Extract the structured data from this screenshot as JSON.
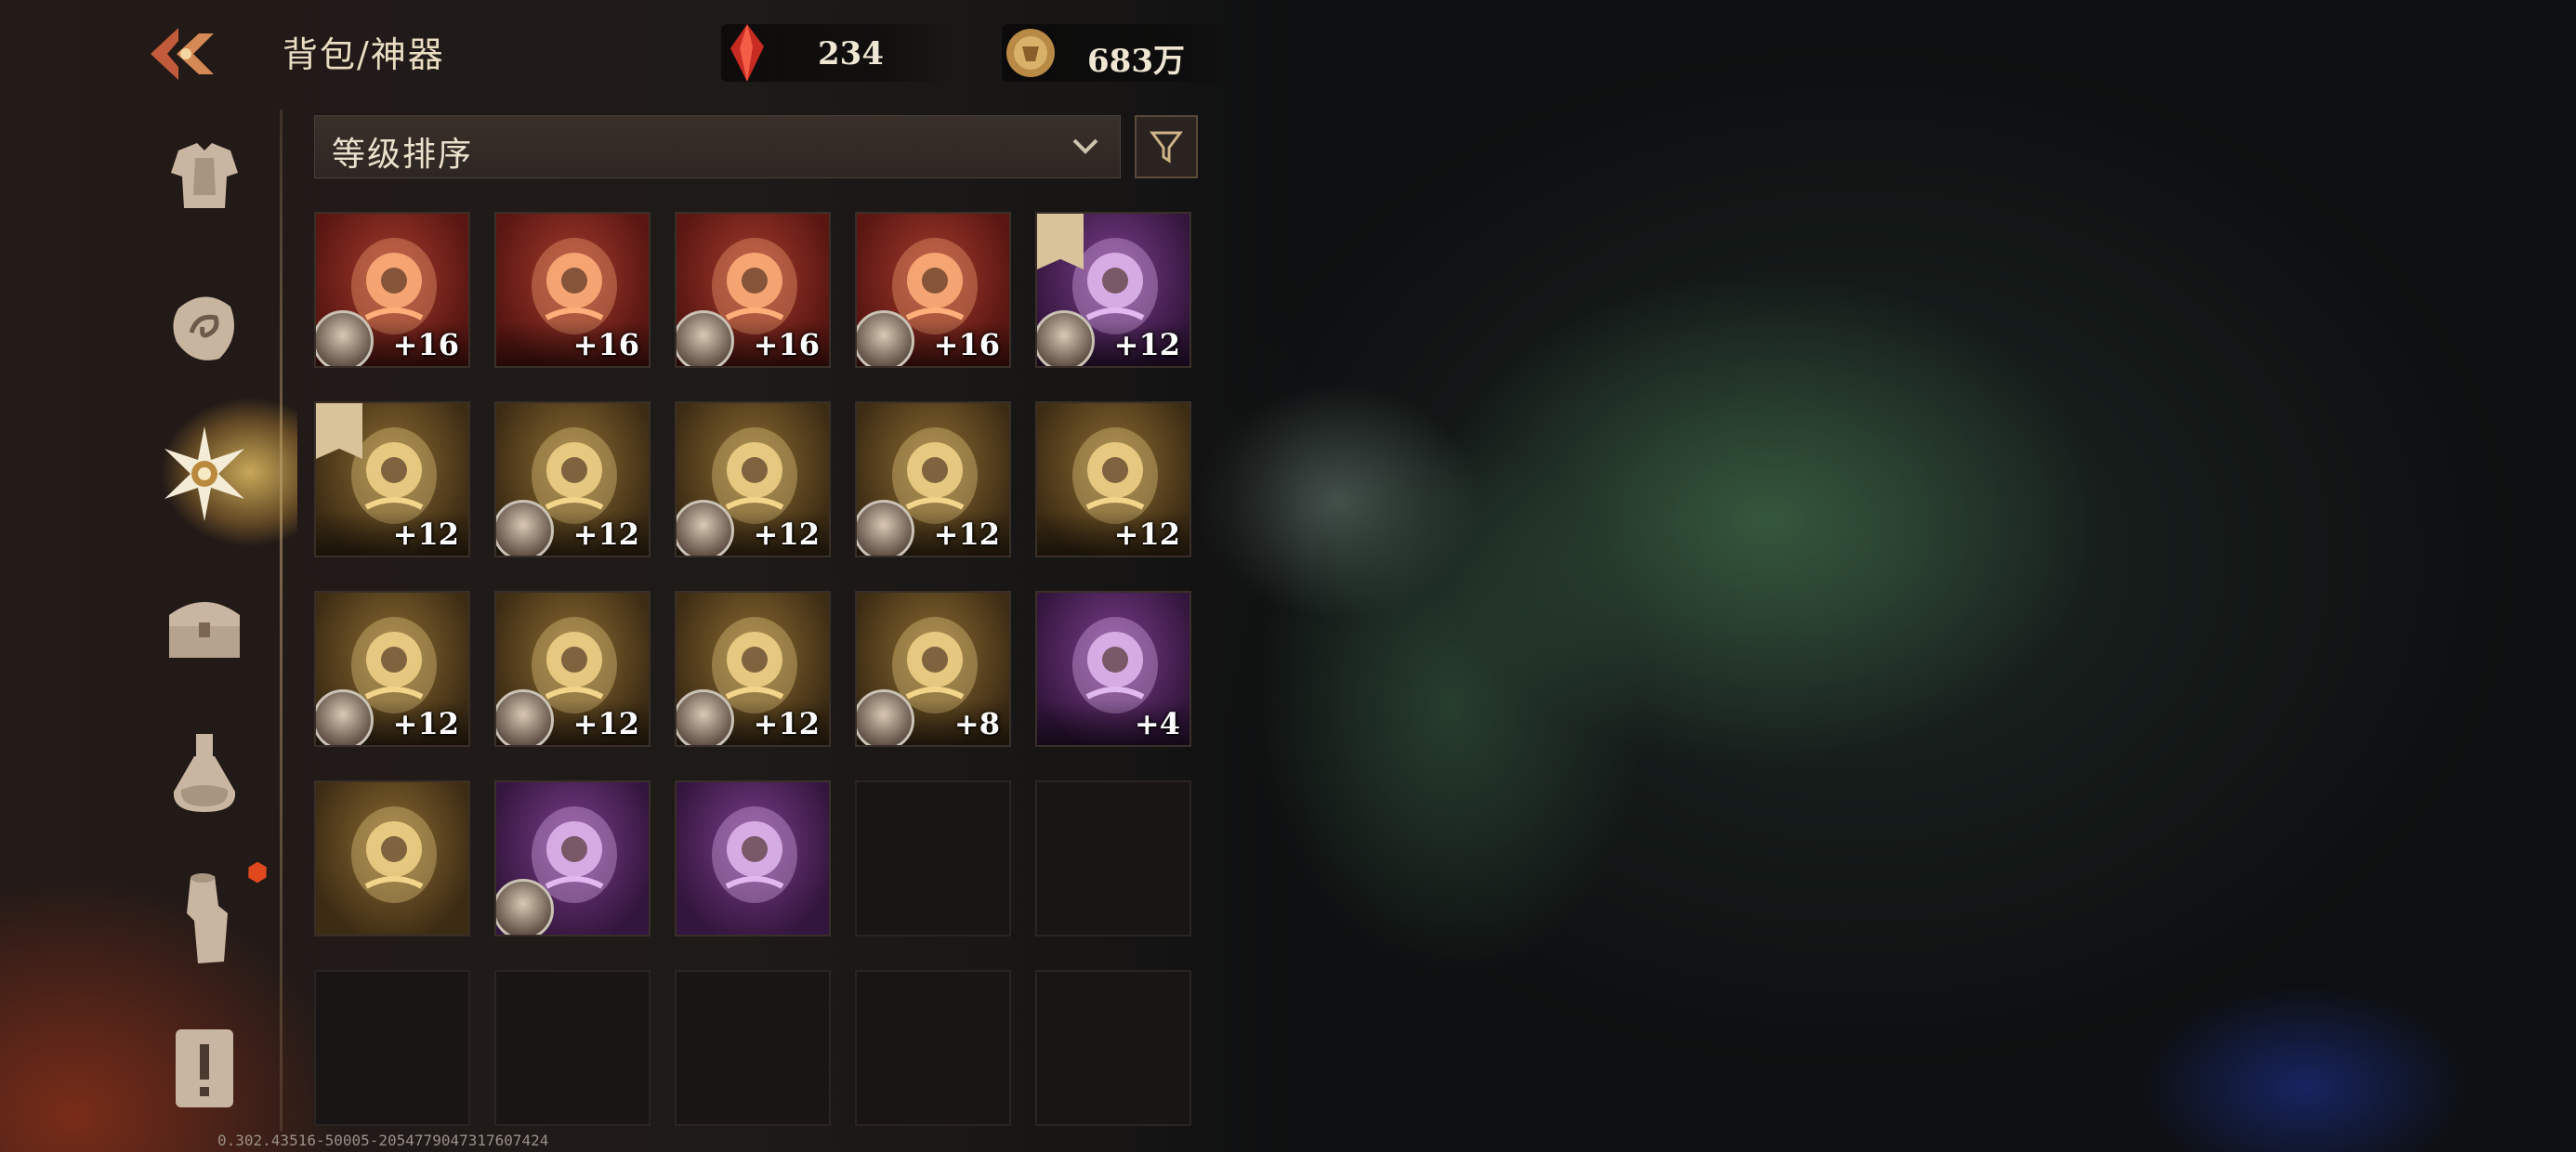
{
  "header": {
    "title": "背包/神器",
    "currencies": [
      {
        "name": "red-crystal",
        "value": "234",
        "color": "#d9352a"
      },
      {
        "name": "gold-coin",
        "value": "683万",
        "color": "#c9a25a"
      }
    ]
  },
  "sidebar": {
    "items": [
      {
        "id": "armor",
        "icon": "chest-armor-icon",
        "active": false
      },
      {
        "id": "rune",
        "icon": "rune-stone-icon",
        "active": false
      },
      {
        "id": "artifact",
        "icon": "sun-emblem-icon",
        "active": true
      },
      {
        "id": "chest",
        "icon": "treasure-chest-icon",
        "active": false
      },
      {
        "id": "potion",
        "icon": "potion-flask-icon",
        "active": false
      },
      {
        "id": "material",
        "icon": "wood-log-icon",
        "active": false,
        "badge": true
      },
      {
        "id": "quest",
        "icon": "scroll-exclamation-icon",
        "active": false
      }
    ]
  },
  "sort": {
    "label": "等级排序"
  },
  "items": [
    {
      "level": "+16",
      "rarity": "red",
      "art": "hourglass",
      "avatar": "blue-hooded"
    },
    {
      "level": "+16",
      "rarity": "red",
      "art": "claw-eye",
      "avatar": ""
    },
    {
      "level": "+16",
      "rarity": "red",
      "art": "golden-halo",
      "avatar": "monkey-sage"
    },
    {
      "level": "+16",
      "rarity": "red",
      "art": "eye-orb",
      "avatar": "old-wizard"
    },
    {
      "level": "+12",
      "rarity": "purple",
      "art": "horned-mask",
      "avatar": "gold-mask",
      "banner": true
    },
    {
      "level": "+12",
      "rarity": "gold",
      "art": "crystal-orb",
      "avatar": "",
      "banner": true
    },
    {
      "level": "+12",
      "rarity": "gold",
      "art": "chalice",
      "avatar": "fire-woman"
    },
    {
      "level": "+12",
      "rarity": "gold",
      "art": "magic-mirror",
      "avatar": "red-hair-woman"
    },
    {
      "level": "+12",
      "rarity": "gold",
      "art": "scarab",
      "avatar": "green-orc"
    },
    {
      "level": "+12",
      "rarity": "gold",
      "art": "thorn-crown",
      "avatar": ""
    },
    {
      "level": "+12",
      "rarity": "gold",
      "art": "coral-crown",
      "avatar": "white-hair-woman"
    },
    {
      "level": "+12",
      "rarity": "gold",
      "art": "ornate-helm",
      "avatar": "undead-face"
    },
    {
      "level": "+12",
      "rarity": "gold",
      "art": "black-urn",
      "avatar": "elf-king"
    },
    {
      "level": "+8",
      "rarity": "gold",
      "art": "red-vial",
      "avatar": "blonde-woman"
    },
    {
      "level": "+4",
      "rarity": "purple",
      "art": "dark-heart",
      "avatar": ""
    },
    {
      "level": "",
      "rarity": "gold",
      "art": "horseshoe",
      "avatar": ""
    },
    {
      "level": "",
      "rarity": "purple",
      "art": "tome",
      "avatar": "bearded-sage"
    },
    {
      "level": "",
      "rarity": "purple",
      "art": "gold-medallion",
      "avatar": ""
    }
  ],
  "footer": {
    "version": "0.302.43516-50005-2054779047317607424"
  }
}
